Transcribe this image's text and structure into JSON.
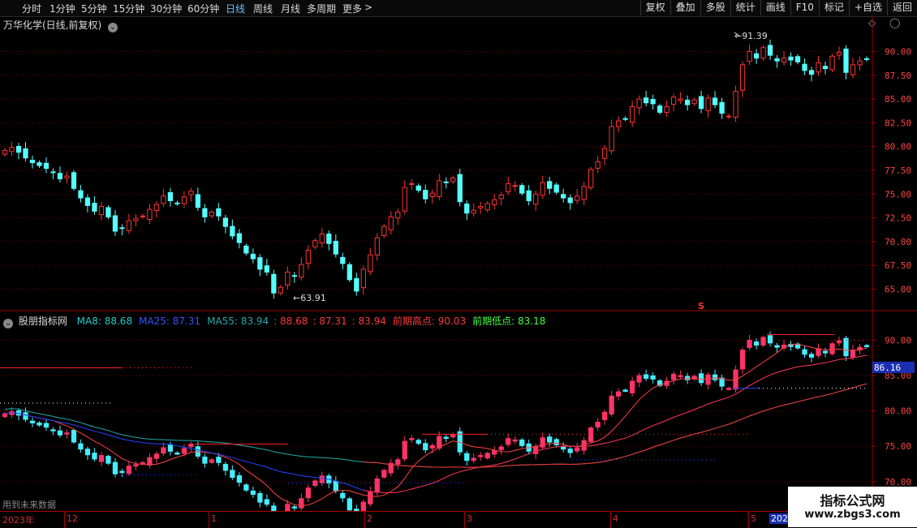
{
  "toolbar": {
    "timeframes": [
      {
        "label": "分时",
        "active": false
      },
      {
        "label": "1分钟",
        "active": false
      },
      {
        "label": "5分钟",
        "active": false
      },
      {
        "label": "15分钟",
        "active": false
      },
      {
        "label": "30分钟",
        "active": false
      },
      {
        "label": "60分钟",
        "active": false
      },
      {
        "label": "日线",
        "active": true
      },
      {
        "label": "周线",
        "active": false
      },
      {
        "label": "月线",
        "active": false
      },
      {
        "label": "多周期",
        "active": false
      },
      {
        "label": "更多",
        "active": false
      }
    ],
    "more_chevron": ">",
    "right_buttons": [
      "复权",
      "叠加",
      "多股",
      "统计",
      "画线",
      "F10",
      "标记",
      "+自选",
      "返回"
    ]
  },
  "main_chart": {
    "title": "万华化学(日线,前复权)",
    "high_marker": "91.39",
    "low_marker": "63.91",
    "y_ticks": [
      "90.00",
      "87.50",
      "85.00",
      "82.50",
      "80.00",
      "77.50",
      "75.00",
      "72.50",
      "70.00",
      "67.50",
      "65.00"
    ],
    "s_marker": "S"
  },
  "indicator": {
    "name": "股朋指标网",
    "values_blue": [
      {
        "text": "MA8: 88.68",
        "color": "#22cccc"
      },
      {
        "text": "MA25: 87.31",
        "color": "#3355ff"
      },
      {
        "text": "MA55: 83.94",
        "color": "#22aaaa"
      }
    ],
    "values_red": [
      ": 88.68",
      ": 87.31",
      ": 83.94"
    ],
    "prev_high": {
      "label": "前期高点",
      "value": "90.03"
    },
    "prev_low": {
      "label": "前期低点",
      "value": "83.18"
    },
    "y_ticks": [
      "90.00",
      "85.00",
      "80.00",
      "75.00",
      "70.00"
    ],
    "current_price": "86.16",
    "future_data": "用到未来数据"
  },
  "date_axis": {
    "labels": [
      "2023年",
      "12",
      "1",
      "2",
      "3",
      "4",
      "5",
      "2024"
    ]
  },
  "watermark": {
    "line1": "指标公式网",
    "line2": "www.zbgs3.com"
  },
  "colors": {
    "up": "#ff3333",
    "down": "#54ffff",
    "grid": "#7a0000",
    "axis": "#a00000"
  },
  "chart_data": [
    {
      "type": "candlestick",
      "title": "万华化学(日线,前复权)",
      "x_start_label": "2023年",
      "month_labels": [
        "12",
        "1",
        "2",
        "3",
        "4",
        "5"
      ],
      "ylim": [
        63,
        92
      ],
      "y_ticks": [
        65,
        67.5,
        70,
        72.5,
        75,
        77.5,
        80,
        82.5,
        85,
        87.5,
        90
      ],
      "closes": [
        79.6,
        79.9,
        79.4,
        78.8,
        78.3,
        78.0,
        77.7,
        77.3,
        76.6,
        76.9,
        75.6,
        74.6,
        73.8,
        73.2,
        73.7,
        72.6,
        71.1,
        71.4,
        72.2,
        72.4,
        72.7,
        73.4,
        73.9,
        74.8,
        74.3,
        74.0,
        74.7,
        75.3,
        73.6,
        72.6,
        73.1,
        72.7,
        71.6,
        70.6,
        69.9,
        68.8,
        68.2,
        67.1,
        66.8,
        64.6,
        65.2,
        66.8,
        66.4,
        67.6,
        69.1,
        70.1,
        70.8,
        69.8,
        68.7,
        67.7,
        66.0,
        64.8,
        67.1,
        68.6,
        70.4,
        71.6,
        72.6,
        73.1,
        75.7,
        76.1,
        75.4,
        74.5,
        75.1,
        76.4,
        76.2,
        76.7,
        74.2,
        73.0,
        73.3,
        73.7,
        74.0,
        74.4,
        74.9,
        76.1,
        75.9,
        75.1,
        74.3,
        75.0,
        76.2,
        75.6,
        75.2,
        74.6,
        74.1,
        74.8,
        75.8,
        77.6,
        78.4,
        79.8,
        82.1,
        82.7,
        82.9,
        84.2,
        85.0,
        84.6,
        84.5,
        83.6,
        84.2,
        85.2,
        85.0,
        84.4,
        84.9,
        84.0,
        85.1,
        84.4,
        83.5,
        83.2,
        85.8,
        88.6,
        90.0,
        89.3,
        90.4,
        89.6,
        89.0,
        89.3,
        89.1,
        88.9,
        88.0,
        87.6,
        88.8,
        88.2,
        89.5,
        89.9,
        87.8,
        88.6,
        89.0,
        89.2
      ],
      "high_label": 91.39,
      "low_label": 63.91
    },
    {
      "type": "line",
      "title": "股朋指标网",
      "ylim": [
        67,
        92
      ],
      "y_ticks": [
        70,
        75,
        80,
        85,
        90
      ],
      "series": [
        {
          "name": "MA8",
          "last": 88.68
        },
        {
          "name": "MA25",
          "last": 87.31
        },
        {
          "name": "MA55",
          "last": 83.94
        },
        {
          "name": "前期高点",
          "last": 90.03
        },
        {
          "name": "前期低点",
          "last": 83.18
        }
      ],
      "current_price": 86.16
    }
  ]
}
